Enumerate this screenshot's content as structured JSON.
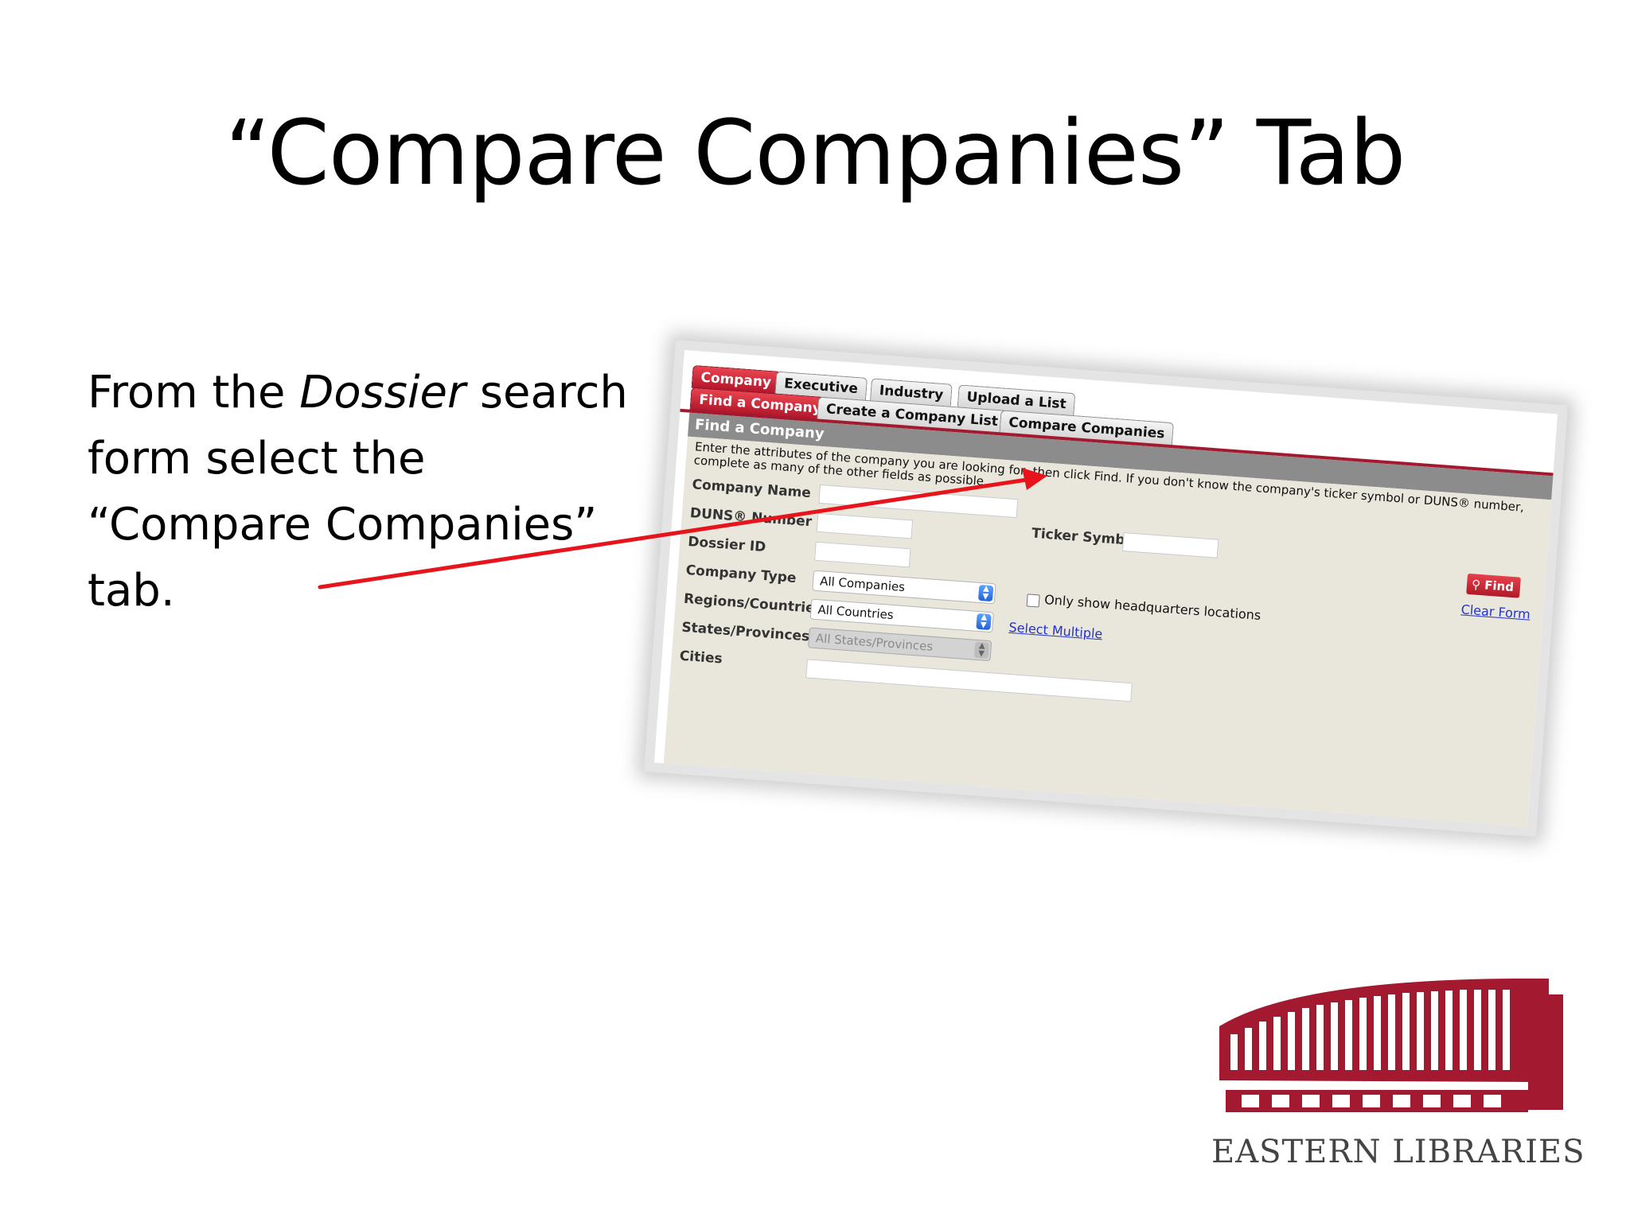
{
  "slide": {
    "title": "“Compare Companies” Tab",
    "body": {
      "prefix": "From the ",
      "emphasis": "Dossier",
      "suffix": " search form select the “Compare Companies” tab."
    }
  },
  "screenshot": {
    "main_tabs": [
      {
        "label": "Company",
        "active": true
      },
      {
        "label": "Executive",
        "active": false
      },
      {
        "label": "Industry",
        "active": false
      },
      {
        "label": "Upload a List",
        "active": false
      }
    ],
    "sub_tabs": [
      {
        "label": "Find a Company",
        "active": true
      },
      {
        "label": "Create a Company List",
        "active": false
      },
      {
        "label": "Compare Companies",
        "active": false
      }
    ],
    "panel_title": "Find a Company",
    "instructions": "Enter the attributes of the company you are looking for, then click Find. If you don't know the company's ticker symbol or DUNS® number, complete as many of the other fields as possible.",
    "fields": {
      "company_name": "Company Name",
      "duns_number": "DUNS® Number",
      "ticker_symbol": "Ticker Symbol",
      "dossier_id": "Dossier ID",
      "company_type": "Company Type",
      "regions_countries": "Regions/Countries",
      "states_provinces": "States/Provinces",
      "cities": "Cities"
    },
    "selects": {
      "company_type_value": "All Companies",
      "regions_value": "All Countries",
      "states_value": "All States/Provinces"
    },
    "find_button": "Find",
    "clear_form": "Clear Form",
    "hq_checkbox_label": "Only show headquarters locations",
    "select_multiple": "Select Multiple",
    "help": "?"
  },
  "logo": {
    "text": "EASTERN LIBRARIES",
    "color": "#a3192f"
  },
  "colors": {
    "arrow": "#e8141b",
    "accent": "#a3192f"
  }
}
